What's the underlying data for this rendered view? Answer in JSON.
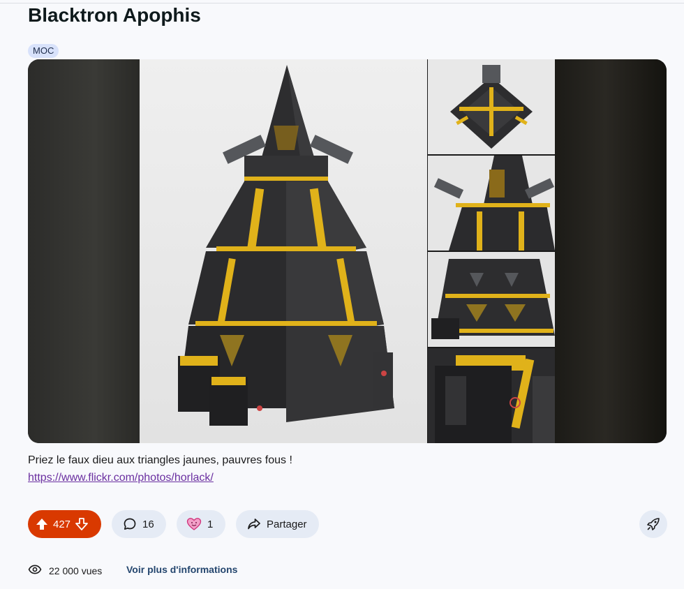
{
  "post": {
    "title": "Blacktron Apophis",
    "flair": "MOC",
    "description": "Priez le faux dieu aux triangles jaunes, pauvres fous !",
    "link": "https://www.flickr.com/photos/horlack/"
  },
  "actions": {
    "votes": "427",
    "comments": "16",
    "awards": "1",
    "share_label": "Partager"
  },
  "footer": {
    "views": "22 000 vues",
    "more_info": "Voir plus d'informations"
  },
  "colors": {
    "upvote_bg": "#d93900",
    "pill_bg": "#e5ebf5",
    "link": "#6a2fa0",
    "brick_black": "#2d2d2f",
    "brick_yellow": "#e0b21a"
  },
  "icons": [
    "upvote-icon",
    "downvote-icon",
    "comment-icon",
    "award-icon",
    "share-icon",
    "boost-icon",
    "eye-icon"
  ]
}
